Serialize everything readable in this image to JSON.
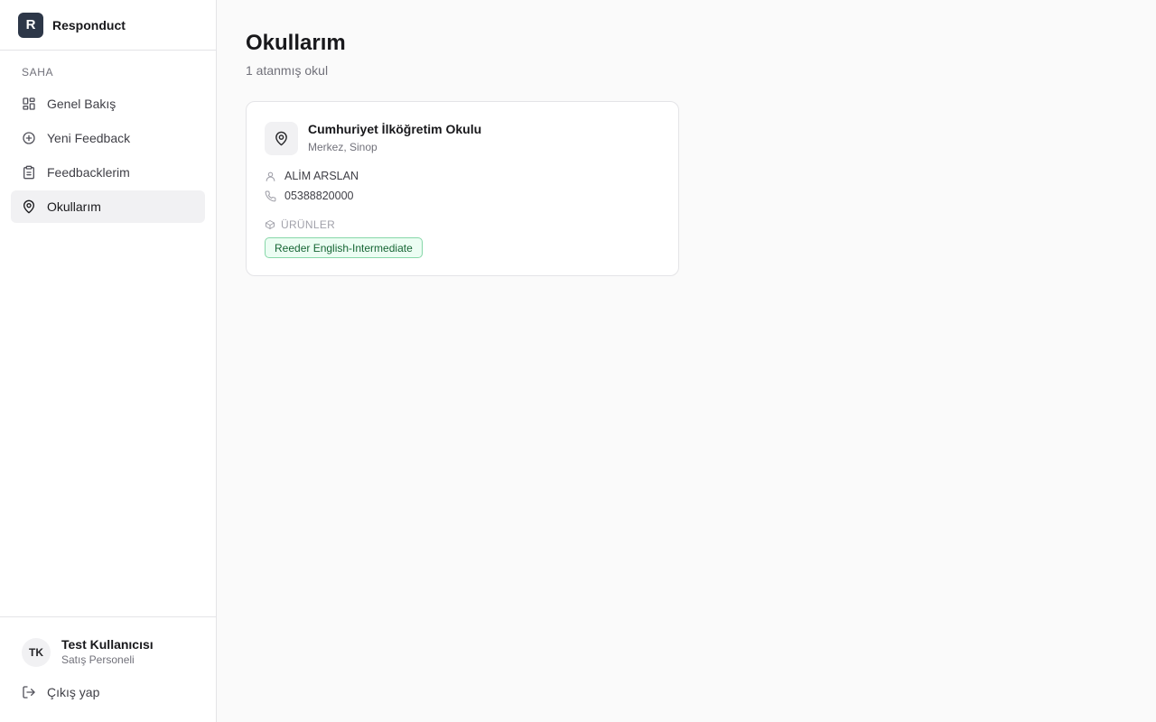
{
  "brand": {
    "logo_letter": "R",
    "name": "Responduct"
  },
  "sidebar": {
    "section_label": "SAHA",
    "items": [
      {
        "label": "Genel Bakış",
        "icon": "layout-grid-icon",
        "active": false
      },
      {
        "label": "Yeni Feedback",
        "icon": "plus-circle-icon",
        "active": false
      },
      {
        "label": "Feedbacklerim",
        "icon": "clipboard-list-icon",
        "active": false
      },
      {
        "label": "Okullarım",
        "icon": "map-pin-icon",
        "active": true
      }
    ]
  },
  "user": {
    "initials": "TK",
    "name": "Test Kullanıcısı",
    "role": "Satış Personeli"
  },
  "logout_label": "Çıkış yap",
  "page": {
    "title": "Okullarım",
    "subtitle": "1 atanmış okul"
  },
  "schools": [
    {
      "name": "Cumhuriyet İlköğretim Okulu",
      "location": "Merkez, Sinop",
      "contact_name": "ALİM ARSLAN",
      "phone": "05388820000",
      "products_label": "ÜRÜNLER",
      "products": [
        "Reeder English-Intermediate"
      ]
    }
  ],
  "colors": {
    "brand_logo_bg": "#2d3748",
    "active_nav_bg": "#f1f1f3",
    "tag_bg": "#ecfdf3",
    "tag_text": "#166534",
    "tag_border": "#86d7a8"
  }
}
